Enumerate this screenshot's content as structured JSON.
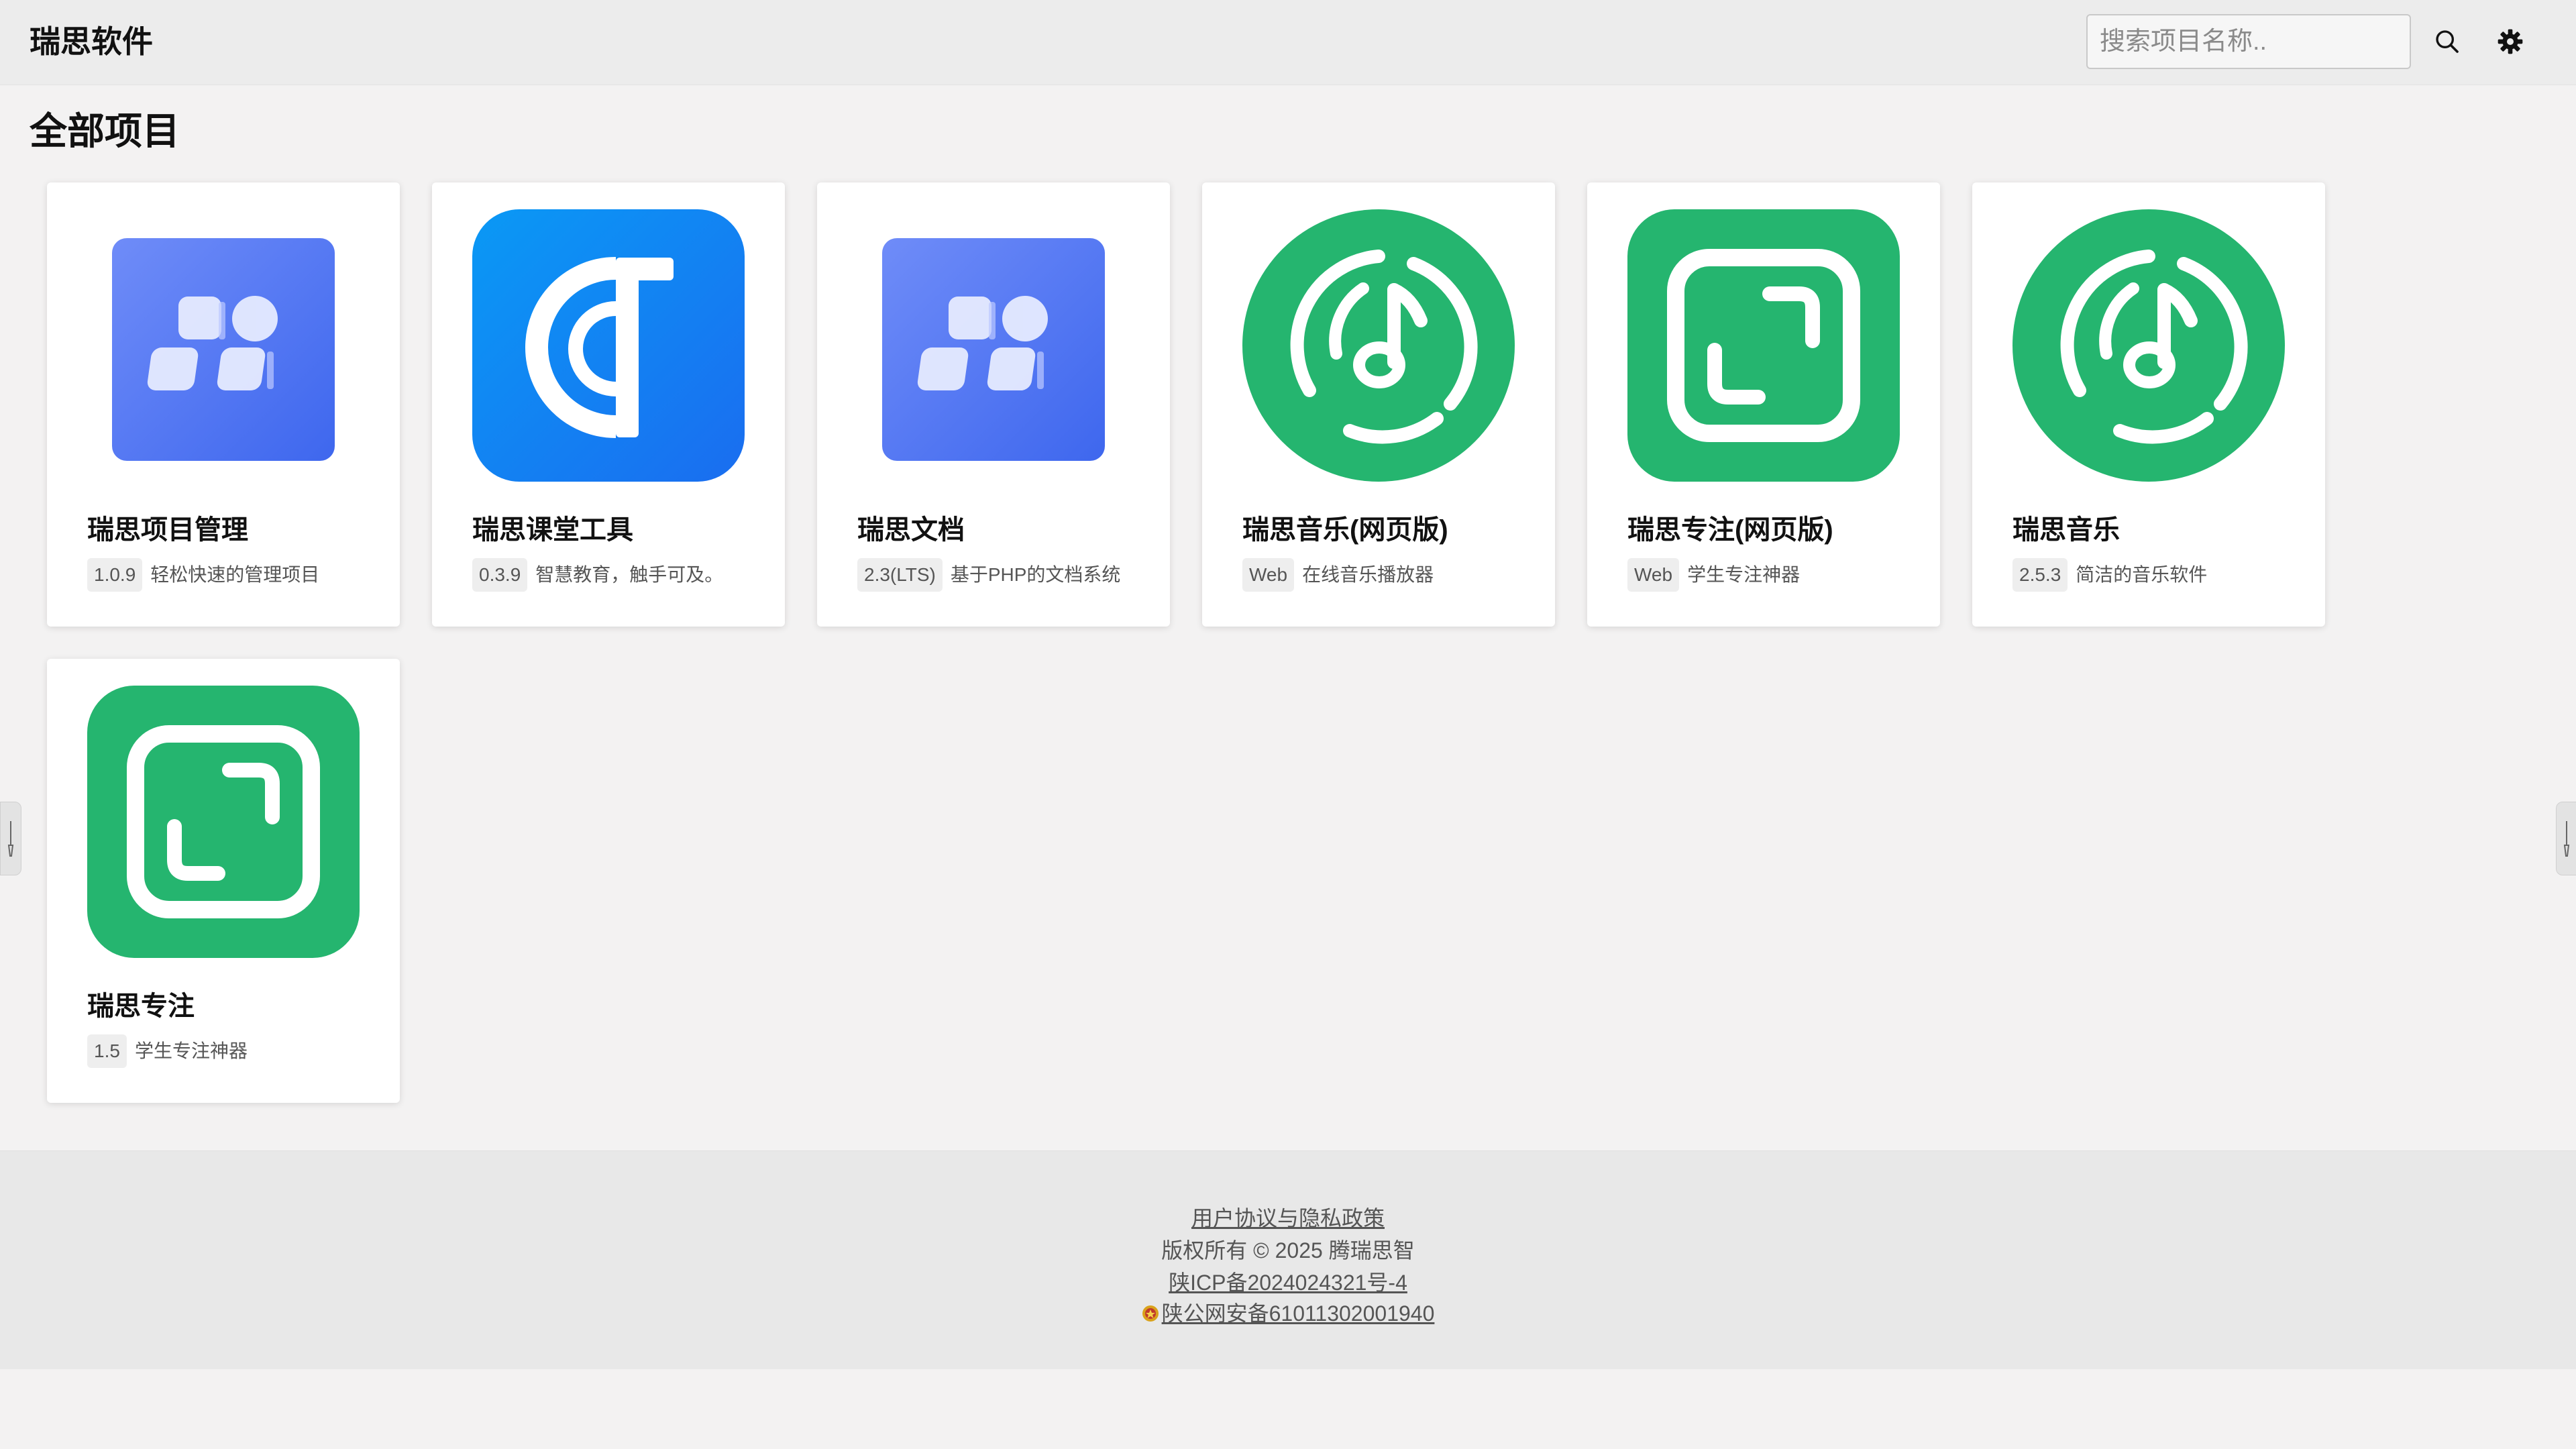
{
  "header": {
    "brand": "瑞思软件",
    "search_placeholder": "搜索项目名称..",
    "search_icon": "search-icon",
    "settings_icon": "gear-icon"
  },
  "page_title": "全部项目",
  "projects": [
    {
      "name": "瑞思项目管理",
      "version": "1.0.9",
      "description": "轻松快速的管理项目",
      "icon": "blocks-icon"
    },
    {
      "name": "瑞思课堂工具",
      "version": "0.3.9",
      "description": "智慧教育，触手可及。",
      "icon": "classroom-logo-icon"
    },
    {
      "name": "瑞思文档",
      "version": "2.3(LTS)",
      "description": "基于PHP的文档系统",
      "icon": "blocks-icon"
    },
    {
      "name": "瑞思音乐(网页版)",
      "version": "Web",
      "description": "在线音乐播放器",
      "icon": "music-disc-icon"
    },
    {
      "name": "瑞思专注(网页版)",
      "version": "Web",
      "description": "学生专注神器",
      "icon": "focus-frame-icon"
    },
    {
      "name": "瑞思音乐",
      "version": "2.5.3",
      "description": "简洁的音乐软件",
      "icon": "music-disc-icon"
    },
    {
      "name": "瑞思专注",
      "version": "1.5",
      "description": "学生专注神器",
      "icon": "focus-frame-icon"
    }
  ],
  "footer": {
    "policy_link": "用户协议与隐私政策",
    "copyright": "版权所有 © 2025 腾瑞思智",
    "icp": "陕ICP备2024024321号-4",
    "police": "陕公网安备61011302001940"
  },
  "colors": {
    "accent_blue": "#1677ff",
    "brand_green": "#25b56f",
    "block_blue": "#4e73f0"
  }
}
